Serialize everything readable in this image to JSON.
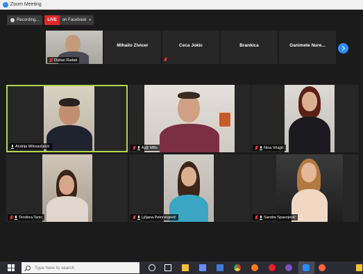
{
  "window": {
    "title": "Zoom Meeting"
  },
  "recording": {
    "label": "Recording..."
  },
  "live": {
    "badge": "LIVE",
    "label": "on Facebook",
    "chevron": "▾"
  },
  "strip": {
    "participants": [
      {
        "name": "Dušan Radak",
        "muted": true,
        "video": true
      },
      {
        "name": "Mihailo Zivicer",
        "muted": false,
        "video": false
      },
      {
        "name": "Ceca Jokic",
        "muted": true,
        "video": false
      },
      {
        "name": "Brankica",
        "muted": false,
        "video": false
      },
      {
        "name": "Ganimete Nure...",
        "muted": false,
        "video": false
      }
    ],
    "next_icon": "chevron-right-icon"
  },
  "grid": {
    "active_border_color": "#b5d54b",
    "participants": [
      {
        "name": "Andrija Milosavljević",
        "muted": false
      },
      {
        "name": "Aj@ MRc",
        "muted": true
      },
      {
        "name": "Nina Vrlajjić",
        "muted": true
      },
      {
        "name": "Teodora Tanic",
        "muted": true
      },
      {
        "name": "Ljiljana Petrićevjević",
        "muted": true
      },
      {
        "name": "Sandra Spasojević",
        "muted": true
      }
    ]
  },
  "taskbar": {
    "search_placeholder": "Type here to search",
    "icons": [
      "windows-icon",
      "search-icon",
      "cortana-icon",
      "task-view-icon",
      "file-explorer-icon",
      "store-icon",
      "mail-icon",
      "chrome-icon",
      "firefox-icon",
      "opera-icon",
      "viber-icon",
      "app-icon",
      "zoom-icon",
      "notification-icon"
    ]
  },
  "colors": {
    "accent": "#2d8cff",
    "live": "#e02828",
    "mute": "#ee3333"
  }
}
